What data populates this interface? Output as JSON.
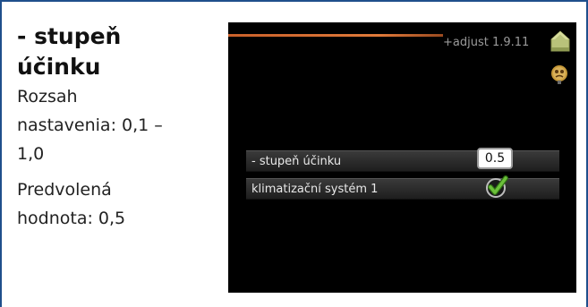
{
  "info": {
    "title_line1": "- stupeň",
    "title_line2": "účinku",
    "range_line1": "Rozsah",
    "range_line2": "nastavenia: 0,1 –",
    "range_line3": "1,0",
    "default_line1": "Predvolená",
    "default_line2": "hodnota: 0,5"
  },
  "screen": {
    "menu_id": "+adjust 1.9.11",
    "icons": [
      "home-icon",
      "help-icon",
      "checkmark-icon"
    ],
    "rows": [
      {
        "label": "- stupeň účinku",
        "value": "0.5"
      },
      {
        "label": "klimatizační systém 1",
        "checked": true
      }
    ]
  },
  "colors": {
    "frame_border": "#1f4f8c",
    "screen_bg": "#000000",
    "accent_line": "#e07a3a",
    "check_green": "#5aa02c"
  }
}
